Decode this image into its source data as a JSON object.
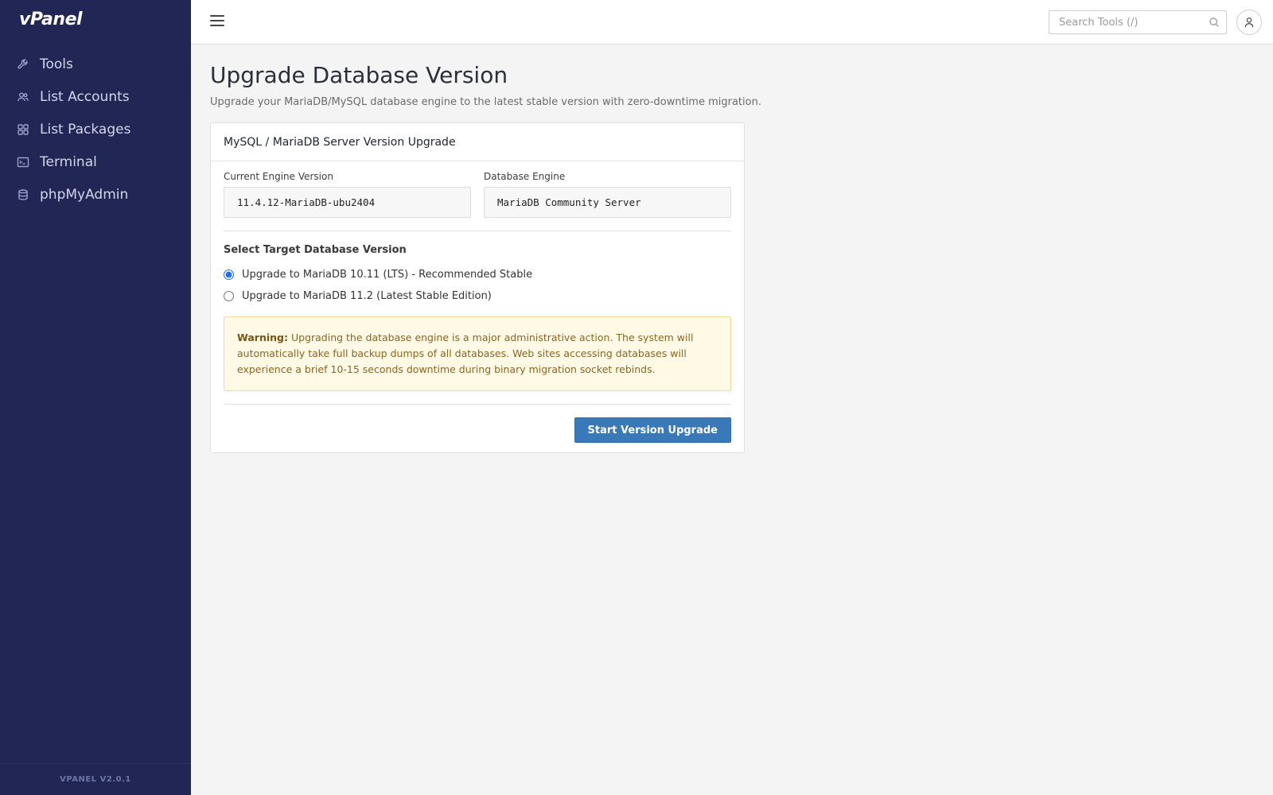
{
  "app": {
    "brand": "vPanel",
    "version": "VPANEL V2.0.1"
  },
  "sidebar": {
    "items": [
      {
        "label": "Tools",
        "icon": "wrench-icon"
      },
      {
        "label": "List Accounts",
        "icon": "users-icon"
      },
      {
        "label": "List Packages",
        "icon": "grid-icon"
      },
      {
        "label": "Terminal",
        "icon": "terminal-icon"
      },
      {
        "label": "phpMyAdmin",
        "icon": "database-icon"
      }
    ]
  },
  "header": {
    "search_placeholder": "Search Tools (/)"
  },
  "page": {
    "title": "Upgrade Database Version",
    "subtitle": "Upgrade your MariaDB/MySQL database engine to the latest stable version with zero-downtime migration."
  },
  "card": {
    "title": "MySQL / MariaDB Server Version Upgrade",
    "current_version_label": "Current Engine Version",
    "current_version_value": "11.4.12-MariaDB-ubu2404",
    "engine_label": "Database Engine",
    "engine_value": "MariaDB Community Server",
    "target_label": "Select Target Database Version",
    "options": [
      {
        "label": "Upgrade to MariaDB 10.11 (LTS) - Recommended Stable",
        "selected": true
      },
      {
        "label": "Upgrade to MariaDB 11.2 (Latest Stable Edition)",
        "selected": false
      }
    ],
    "warning_title": "Warning:",
    "warning_text": "Upgrading the database engine is a major administrative action. The system will automatically take full backup dumps of all databases. Web sites accessing databases will experience a brief 10-15 seconds downtime during binary migration socket rebinds.",
    "submit_label": "Start Version Upgrade"
  },
  "colors": {
    "sidebar_bg": "#212654",
    "primary_button": "#3a79b8",
    "warning_bg": "#fff9e6"
  }
}
